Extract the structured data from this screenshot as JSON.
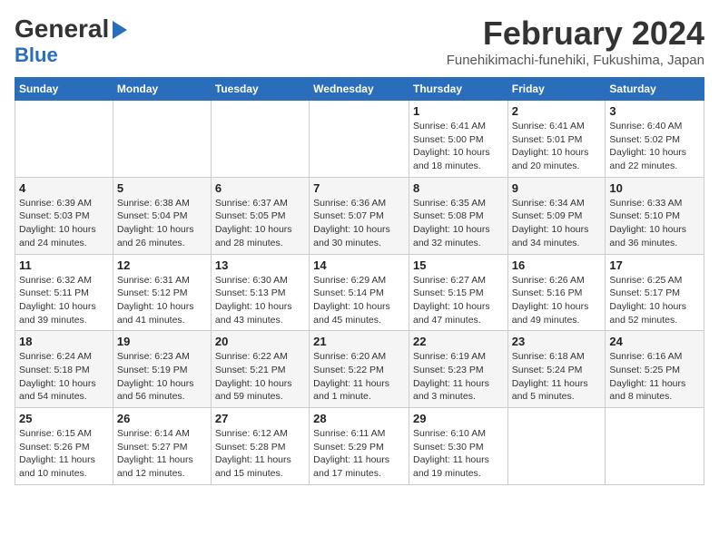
{
  "header": {
    "logo_line1": "General",
    "logo_line2": "Blue",
    "title": "February 2024",
    "subtitle": "Funehikimachi-funehiki, Fukushima, Japan"
  },
  "calendar": {
    "days_of_week": [
      "Sunday",
      "Monday",
      "Tuesday",
      "Wednesday",
      "Thursday",
      "Friday",
      "Saturday"
    ],
    "weeks": [
      [
        {
          "day": "",
          "info": ""
        },
        {
          "day": "",
          "info": ""
        },
        {
          "day": "",
          "info": ""
        },
        {
          "day": "",
          "info": ""
        },
        {
          "day": "1",
          "info": "Sunrise: 6:41 AM\nSunset: 5:00 PM\nDaylight: 10 hours and 18 minutes."
        },
        {
          "day": "2",
          "info": "Sunrise: 6:41 AM\nSunset: 5:01 PM\nDaylight: 10 hours and 20 minutes."
        },
        {
          "day": "3",
          "info": "Sunrise: 6:40 AM\nSunset: 5:02 PM\nDaylight: 10 hours and 22 minutes."
        }
      ],
      [
        {
          "day": "4",
          "info": "Sunrise: 6:39 AM\nSunset: 5:03 PM\nDaylight: 10 hours and 24 minutes."
        },
        {
          "day": "5",
          "info": "Sunrise: 6:38 AM\nSunset: 5:04 PM\nDaylight: 10 hours and 26 minutes."
        },
        {
          "day": "6",
          "info": "Sunrise: 6:37 AM\nSunset: 5:05 PM\nDaylight: 10 hours and 28 minutes."
        },
        {
          "day": "7",
          "info": "Sunrise: 6:36 AM\nSunset: 5:07 PM\nDaylight: 10 hours and 30 minutes."
        },
        {
          "day": "8",
          "info": "Sunrise: 6:35 AM\nSunset: 5:08 PM\nDaylight: 10 hours and 32 minutes."
        },
        {
          "day": "9",
          "info": "Sunrise: 6:34 AM\nSunset: 5:09 PM\nDaylight: 10 hours and 34 minutes."
        },
        {
          "day": "10",
          "info": "Sunrise: 6:33 AM\nSunset: 5:10 PM\nDaylight: 10 hours and 36 minutes."
        }
      ],
      [
        {
          "day": "11",
          "info": "Sunrise: 6:32 AM\nSunset: 5:11 PM\nDaylight: 10 hours and 39 minutes."
        },
        {
          "day": "12",
          "info": "Sunrise: 6:31 AM\nSunset: 5:12 PM\nDaylight: 10 hours and 41 minutes."
        },
        {
          "day": "13",
          "info": "Sunrise: 6:30 AM\nSunset: 5:13 PM\nDaylight: 10 hours and 43 minutes."
        },
        {
          "day": "14",
          "info": "Sunrise: 6:29 AM\nSunset: 5:14 PM\nDaylight: 10 hours and 45 minutes."
        },
        {
          "day": "15",
          "info": "Sunrise: 6:27 AM\nSunset: 5:15 PM\nDaylight: 10 hours and 47 minutes."
        },
        {
          "day": "16",
          "info": "Sunrise: 6:26 AM\nSunset: 5:16 PM\nDaylight: 10 hours and 49 minutes."
        },
        {
          "day": "17",
          "info": "Sunrise: 6:25 AM\nSunset: 5:17 PM\nDaylight: 10 hours and 52 minutes."
        }
      ],
      [
        {
          "day": "18",
          "info": "Sunrise: 6:24 AM\nSunset: 5:18 PM\nDaylight: 10 hours and 54 minutes."
        },
        {
          "day": "19",
          "info": "Sunrise: 6:23 AM\nSunset: 5:19 PM\nDaylight: 10 hours and 56 minutes."
        },
        {
          "day": "20",
          "info": "Sunrise: 6:22 AM\nSunset: 5:21 PM\nDaylight: 10 hours and 59 minutes."
        },
        {
          "day": "21",
          "info": "Sunrise: 6:20 AM\nSunset: 5:22 PM\nDaylight: 11 hours and 1 minute."
        },
        {
          "day": "22",
          "info": "Sunrise: 6:19 AM\nSunset: 5:23 PM\nDaylight: 11 hours and 3 minutes."
        },
        {
          "day": "23",
          "info": "Sunrise: 6:18 AM\nSunset: 5:24 PM\nDaylight: 11 hours and 5 minutes."
        },
        {
          "day": "24",
          "info": "Sunrise: 6:16 AM\nSunset: 5:25 PM\nDaylight: 11 hours and 8 minutes."
        }
      ],
      [
        {
          "day": "25",
          "info": "Sunrise: 6:15 AM\nSunset: 5:26 PM\nDaylight: 11 hours and 10 minutes."
        },
        {
          "day": "26",
          "info": "Sunrise: 6:14 AM\nSunset: 5:27 PM\nDaylight: 11 hours and 12 minutes."
        },
        {
          "day": "27",
          "info": "Sunrise: 6:12 AM\nSunset: 5:28 PM\nDaylight: 11 hours and 15 minutes."
        },
        {
          "day": "28",
          "info": "Sunrise: 6:11 AM\nSunset: 5:29 PM\nDaylight: 11 hours and 17 minutes."
        },
        {
          "day": "29",
          "info": "Sunrise: 6:10 AM\nSunset: 5:30 PM\nDaylight: 11 hours and 19 minutes."
        },
        {
          "day": "",
          "info": ""
        },
        {
          "day": "",
          "info": ""
        }
      ]
    ]
  }
}
